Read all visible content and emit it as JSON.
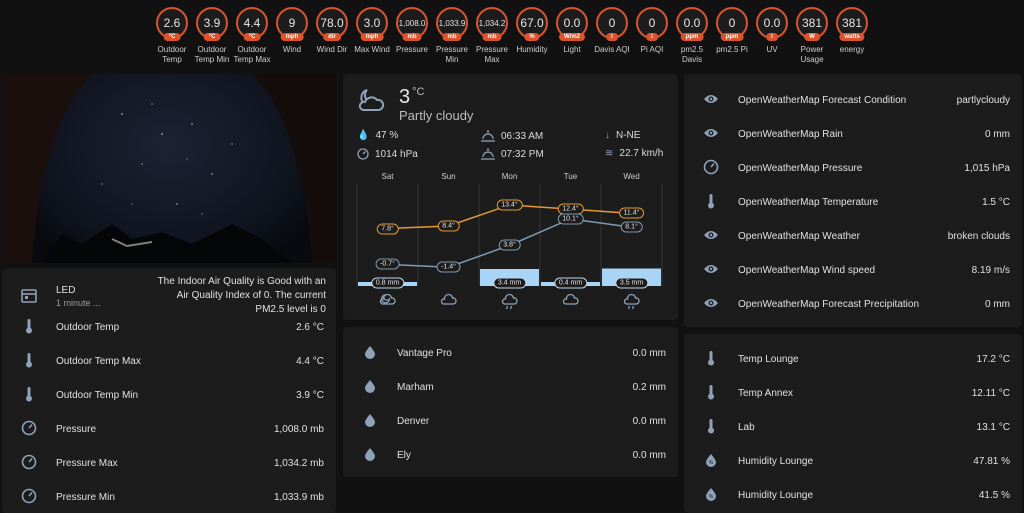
{
  "badges": [
    {
      "value": "2.6",
      "unit": "°C",
      "label": "Outdoor Temp"
    },
    {
      "value": "3.9",
      "unit": "°C",
      "label": "Outdoor Temp Min"
    },
    {
      "value": "4.4",
      "unit": "°C",
      "label": "Outdoor Temp Max"
    },
    {
      "value": "9",
      "unit": "mph",
      "label": "Wind"
    },
    {
      "value": "78.0",
      "unit": "dir",
      "label": "Wind Dir"
    },
    {
      "value": "3.0",
      "unit": "mph",
      "label": "Max Wind"
    },
    {
      "value": "1,008.0",
      "unit": "mb",
      "label": "Pressure"
    },
    {
      "value": "1,033.9",
      "unit": "mb",
      "label": "Pressure Min"
    },
    {
      "value": "1,034.2",
      "unit": "mb",
      "label": "Pressure Max"
    },
    {
      "value": "67.0",
      "unit": "%",
      "label": "Humidity"
    },
    {
      "value": "0.0",
      "unit": "W/m2",
      "label": "Light"
    },
    {
      "value": "0",
      "unit": "i",
      "label": "Davis AQI"
    },
    {
      "value": "0",
      "unit": "i",
      "label": "Pi AQI"
    },
    {
      "value": "0.0",
      "unit": "ppm",
      "label": "pm2.5 Davis"
    },
    {
      "value": "0",
      "unit": "ppm",
      "label": "pm2.5 Pi"
    },
    {
      "value": "0.0",
      "unit": "i",
      "label": "UV"
    },
    {
      "value": "381",
      "unit": "W",
      "label": "Power Usage"
    },
    {
      "value": "381",
      "unit": "watts",
      "label": "energy"
    }
  ],
  "left_list": {
    "led": {
      "title": "LED",
      "subtitle": "1 minute ...",
      "text": "The Indoor Air Quality is Good with an Air Quality Index of 0. The current PM2.5 level is 0"
    },
    "items": [
      {
        "icon": "thermometer-icon",
        "name": "Outdoor Temp",
        "value": "2.6 °C"
      },
      {
        "icon": "thermometer-icon",
        "name": "Outdoor Temp Max",
        "value": "4.4 °C"
      },
      {
        "icon": "thermometer-icon",
        "name": "Outdoor Temp Min",
        "value": "3.9 °C"
      },
      {
        "icon": "gauge-icon",
        "name": "Pressure",
        "value": "1,008.0 mb"
      },
      {
        "icon": "gauge-icon",
        "name": "Pressure Max",
        "value": "1,034.2 mb"
      },
      {
        "icon": "gauge-icon",
        "name": "Pressure Min",
        "value": "1,033.9 mb"
      }
    ]
  },
  "weather": {
    "temp": "3",
    "unit": "°C",
    "condition": "Partly cloudy",
    "humidity": "47 %",
    "pressure": "1014 hPa",
    "sunrise": "06:33 AM",
    "sunset": "07:32 PM",
    "wind_dir": "N-NE",
    "wind_speed": "22.7 km/h",
    "forecast": [
      {
        "day": "Sat",
        "high": 7.8,
        "low": -0.7,
        "high_label": "7.8°",
        "low_label": "-0.7°",
        "precip": 0.8,
        "precip_label": "0.8 mm",
        "icon": "partly-cloudy-night-icon"
      },
      {
        "day": "Sun",
        "high": 8.4,
        "low": -1.4,
        "high_label": "8.4°",
        "low_label": "-1.4°",
        "precip": null,
        "precip_label": "",
        "icon": "cloudy-icon"
      },
      {
        "day": "Mon",
        "high": 13.4,
        "low": 3.8,
        "high_label": "13.4°",
        "low_label": "3.8°",
        "precip": 3.4,
        "precip_label": "3.4 mm",
        "icon": "rainy-icon"
      },
      {
        "day": "Tue",
        "high": 12.4,
        "low": 10.1,
        "high_label": "12.4°",
        "low_label": "10.1°",
        "precip": 0.4,
        "precip_label": "0.4 mm",
        "icon": "cloudy-icon"
      },
      {
        "day": "Wed",
        "high": 11.4,
        "low": 8.1,
        "high_label": "11.4°",
        "low_label": "8.1°",
        "precip": 3.5,
        "precip_label": "3.5 mm",
        "icon": "rainy-icon"
      }
    ]
  },
  "rain_list": [
    {
      "name": "Vantage Pro",
      "value": "0.0 mm"
    },
    {
      "name": "Marham",
      "value": "0.2 mm"
    },
    {
      "name": "Denver",
      "value": "0.0 mm"
    },
    {
      "name": "Ely",
      "value": "0.0 mm"
    }
  ],
  "owm_list": [
    {
      "icon": "eye-icon",
      "name": "OpenWeatherMap Forecast Condition",
      "value": "partlycloudy"
    },
    {
      "icon": "eye-icon",
      "name": "OpenWeatherMap Rain",
      "value": "0 mm"
    },
    {
      "icon": "gauge-icon",
      "name": "OpenWeatherMap Pressure",
      "value": "1,015 hPa"
    },
    {
      "icon": "thermometer-icon",
      "name": "OpenWeatherMap Temperature",
      "value": "1.5 °C"
    },
    {
      "icon": "eye-icon",
      "name": "OpenWeatherMap Weather",
      "value": "broken clouds"
    },
    {
      "icon": "eye-icon",
      "name": "OpenWeatherMap Wind speed",
      "value": "8.19 m/s"
    },
    {
      "icon": "eye-icon",
      "name": "OpenWeatherMap Forecast Precipitation",
      "value": "0 mm"
    }
  ],
  "indoor_list": [
    {
      "icon": "thermometer-icon",
      "name": "Temp Lounge",
      "value": "17.2 °C"
    },
    {
      "icon": "thermometer-icon",
      "name": "Temp Annex",
      "value": "12.11 °C"
    },
    {
      "icon": "thermometer-icon",
      "name": "Lab",
      "value": "13.1 °C"
    },
    {
      "icon": "humidity-icon",
      "name": "Humidity Lounge",
      "value": "47.81 %"
    },
    {
      "icon": "humidity-icon",
      "name": "Humidity Lounge",
      "value": "41.5 %"
    }
  ],
  "colors": {
    "accent": "#d9532c",
    "high_line": "#e59a2e",
    "low_line": "#7e9ab5",
    "precip_bar": "#a8d4f5",
    "card": "#1c1c1c",
    "background": "#111111"
  }
}
